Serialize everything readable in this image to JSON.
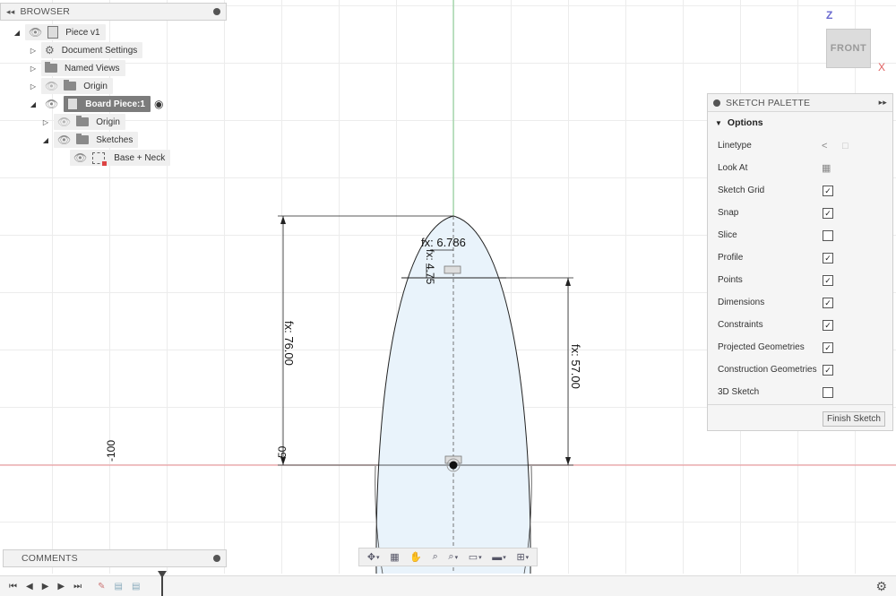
{
  "browser": {
    "title": "BROWSER",
    "items": [
      {
        "label": "Piece v1"
      },
      {
        "label": "Document Settings"
      },
      {
        "label": "Named Views"
      },
      {
        "label": "Origin"
      },
      {
        "label": "Board Piece:1"
      },
      {
        "label": "Origin"
      },
      {
        "label": "Sketches"
      },
      {
        "label": "Base + Neck"
      }
    ]
  },
  "viewcube": {
    "face": "FRONT",
    "axis_z": "Z",
    "axis_x": "X"
  },
  "palette": {
    "title": "SKETCH PALETTE",
    "options_title": "Options",
    "rows": [
      {
        "label": "Linetype",
        "kind": "icons"
      },
      {
        "label": "Look At",
        "kind": "icon"
      },
      {
        "label": "Sketch Grid",
        "checked": true
      },
      {
        "label": "Snap",
        "checked": true
      },
      {
        "label": "Slice",
        "checked": false
      },
      {
        "label": "Profile",
        "checked": true
      },
      {
        "label": "Points",
        "checked": true
      },
      {
        "label": "Dimensions",
        "checked": true
      },
      {
        "label": "Constraints",
        "checked": true
      },
      {
        "label": "Projected Geometries",
        "checked": true
      },
      {
        "label": "Construction Geometries",
        "checked": true
      },
      {
        "label": "3D Sketch",
        "checked": false
      }
    ],
    "finish_label": "Finish Sketch"
  },
  "dimensions": {
    "width_top": "fx: 6.786",
    "offset": "fx: 4.75",
    "height_total": "fx: 76.00",
    "height_right": "fx: 57.00",
    "ruler_a": "-100",
    "ruler_b": "-50"
  },
  "comments": {
    "title": "COMMENTS"
  },
  "colors": {
    "axis_red": "#e8898c",
    "axis_green": "#7fc98a",
    "profile_fill": "#e9f3fb",
    "accent": "#4a4a4a"
  }
}
